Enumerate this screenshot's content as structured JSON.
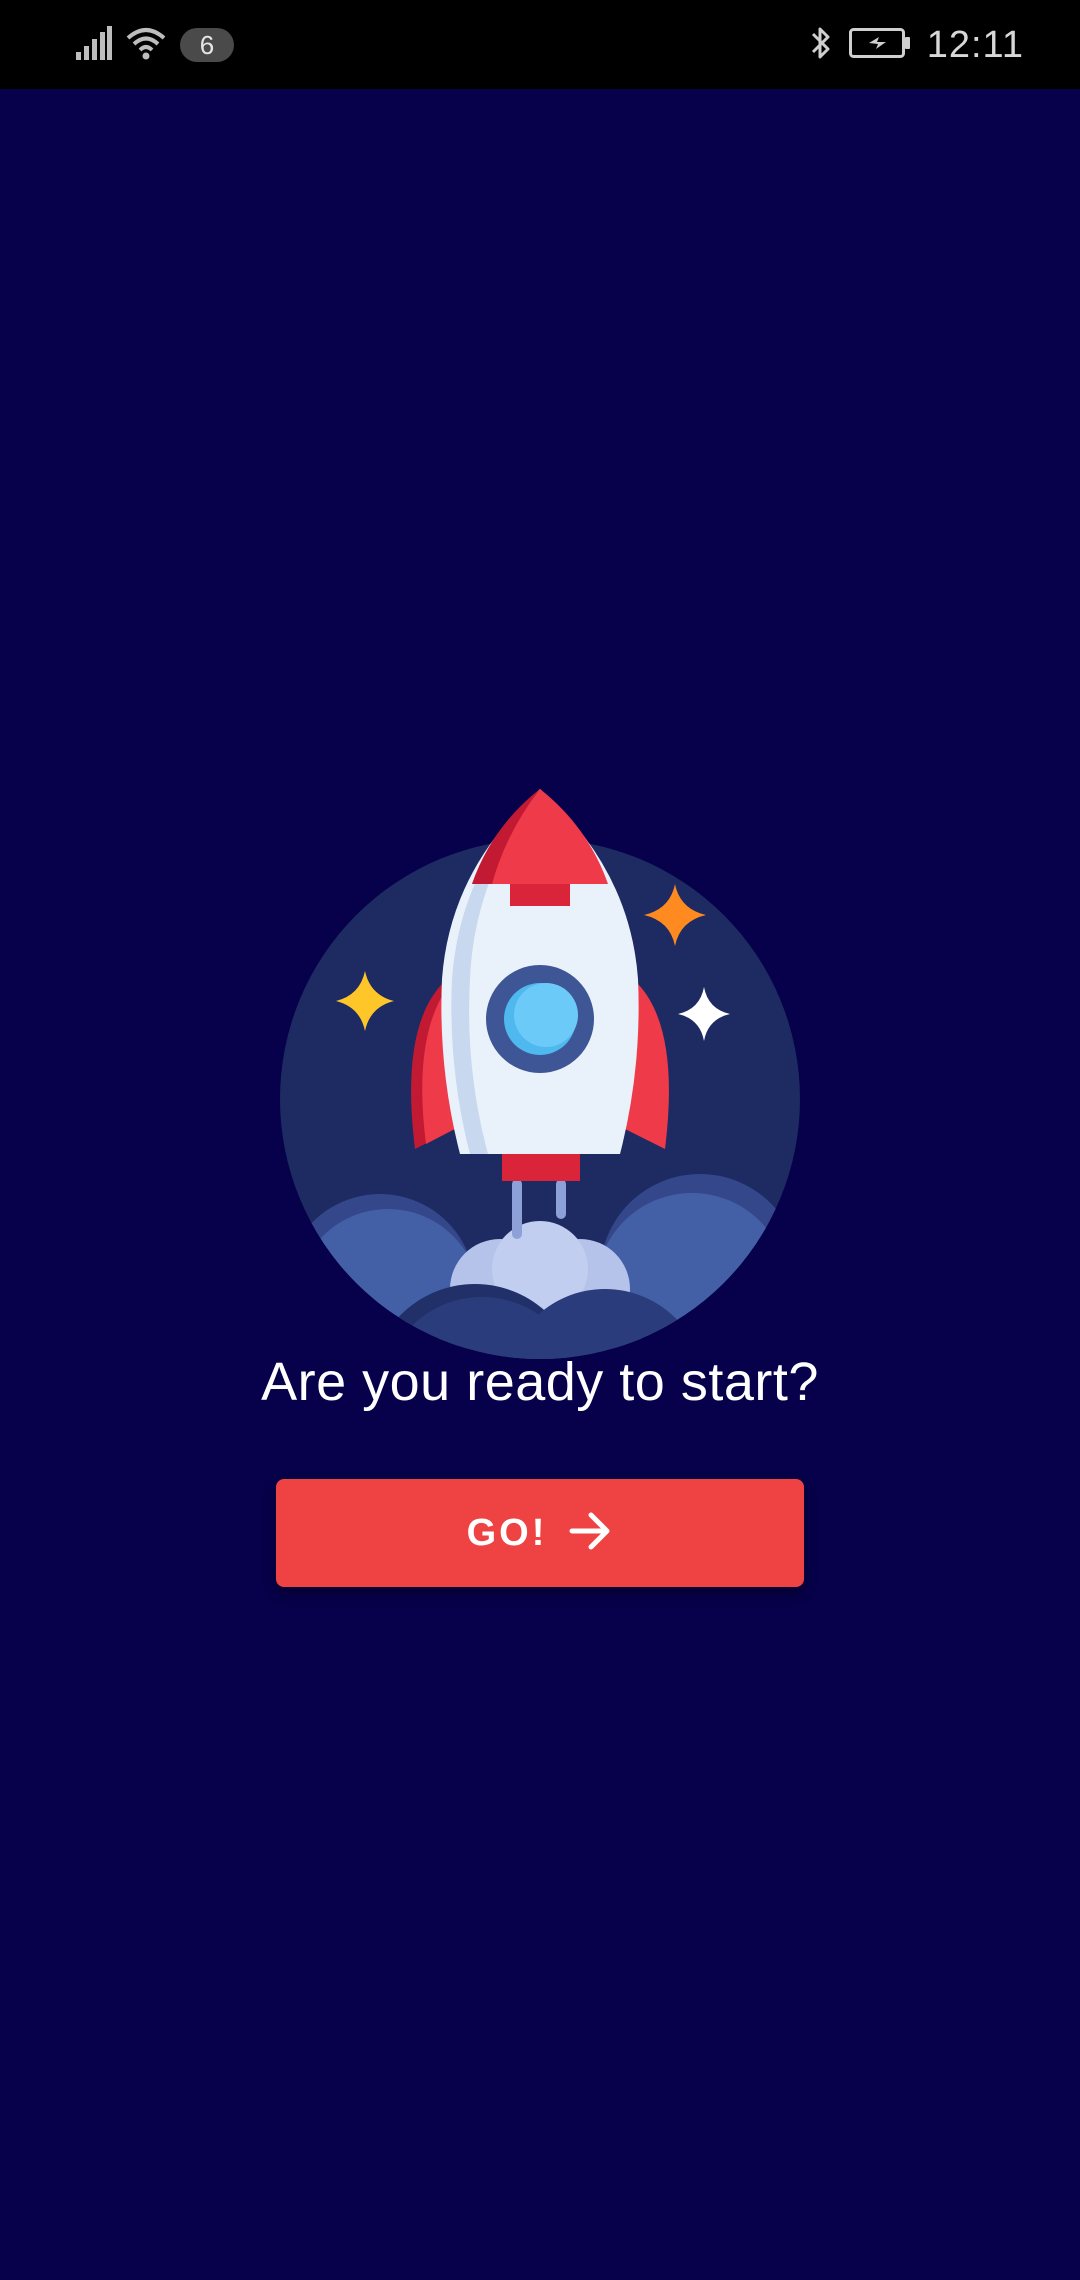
{
  "status_bar": {
    "notification_count": "6",
    "time": "12:11",
    "icons": [
      "signal-icon",
      "wifi-icon",
      "bluetooth-icon",
      "battery-charging-icon"
    ]
  },
  "onboarding": {
    "illustration": "rocket-launch-illustration",
    "headline": "Are you ready to start?",
    "go_button_label": "GO!",
    "go_button_icon": "arrow-right-icon"
  },
  "colors": {
    "background": "#07004a",
    "status_bar": "#000000",
    "button": "#ef4242",
    "circle": "#1d2b62"
  }
}
